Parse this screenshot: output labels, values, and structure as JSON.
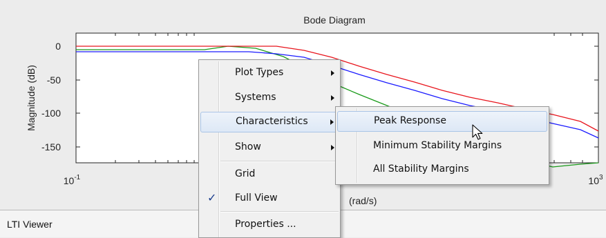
{
  "plot": {
    "title": "Bode Diagram",
    "ylabel": "Magnitude (dB)",
    "xlabel_visible": "(rad/s)",
    "y_ticks": [
      "0",
      "-50",
      "-100",
      "-150"
    ],
    "x_tick_left": {
      "base": "10",
      "exp": "-1"
    },
    "x_tick_right": {
      "base": "10",
      "exp": "3"
    },
    "colors": {
      "red": "#e8141c",
      "blue": "#1a1aff",
      "green": "#1a9a1a"
    }
  },
  "context_menu": {
    "items": [
      {
        "label": "Plot Types",
        "submenu": true
      },
      {
        "label": "Systems",
        "submenu": true
      },
      {
        "label": "Characteristics",
        "submenu": true,
        "highlighted": true
      },
      {
        "label": "Show",
        "submenu": true
      },
      {
        "label": "Grid"
      },
      {
        "label": "Full View",
        "checked": true,
        "check_glyph": "✓"
      },
      {
        "label": "Properties ..."
      }
    ]
  },
  "characteristics_submenu": {
    "items": [
      {
        "label": "Peak Response",
        "highlighted": true
      },
      {
        "label": "Minimum Stability Margins"
      },
      {
        "label": "All Stability Margins"
      }
    ]
  },
  "status_bar": {
    "text": "LTI Viewer"
  },
  "cursor": {
    "icon": "mouse-pointer-icon"
  }
}
